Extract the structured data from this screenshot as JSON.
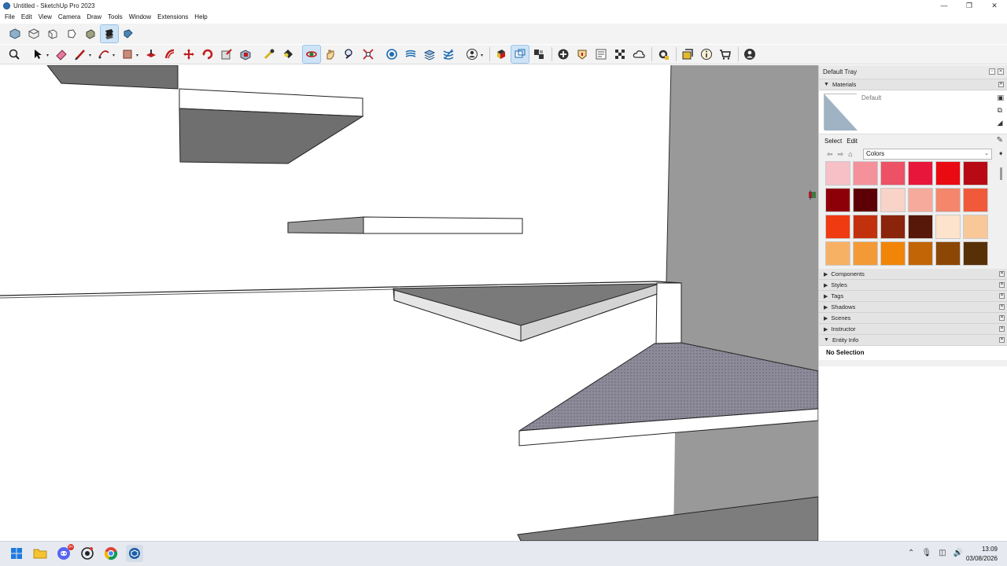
{
  "window": {
    "title": "Untitled - SketchUp Pro 2023",
    "minimize": "—",
    "maximize": "❐",
    "close": "✕"
  },
  "menu": [
    "File",
    "Edit",
    "View",
    "Camera",
    "Draw",
    "Tools",
    "Window",
    "Extensions",
    "Help"
  ],
  "toolbar_views": [
    "iso-view-icon",
    "top-view-icon",
    "front-view-icon",
    "right-view-icon",
    "back-view-icon",
    "left-view-icon",
    "bottom-view-icon"
  ],
  "toolbar_main": [
    "zoom-window-icon",
    "select-icon",
    "eraser-icon",
    "line-icon",
    "arc-icon",
    "rectangle-icon",
    "push-pull-icon",
    "offset-icon",
    "move-icon",
    "rotate-icon",
    "scale-icon",
    "follow-me-icon",
    "tape-measure-icon",
    "paint-bucket-icon",
    "orbit-icon",
    "pan-icon",
    "zoom-icon",
    "zoom-extents-icon",
    "section-plane-icon",
    "sandbox-icon",
    "layers-icon",
    "styles-icon",
    "user-icon",
    "components-icon",
    "solid-tools-icon",
    "scenes-icon",
    "add-location-icon",
    "geo-icon",
    "model-info-icon",
    "photo-texture-icon",
    "cloud-icon",
    "extension-manager-icon",
    "outliner-icon",
    "info-icon",
    "warehouse-icon",
    "account-icon"
  ],
  "tray": {
    "title": "Default Tray",
    "materials": {
      "panel_title": "Materials",
      "current_name": "Default",
      "tab_select": "Select",
      "tab_edit": "Edit",
      "collection": "Colors",
      "swatches": [
        "#f7c0c7",
        "#f4919a",
        "#ec5166",
        "#e8163a",
        "#ea0a12",
        "#b80a14",
        "#8e0008",
        "#5c0005",
        "#f9d2c8",
        "#f6aa9b",
        "#f4866b",
        "#f05a3a",
        "#ef3a12",
        "#c2310d",
        "#8a240b",
        "#581809",
        "#fde3cb",
        "#f9c899",
        "#f7b164",
        "#f39a36",
        "#f08508",
        "#c26506",
        "#8c4706",
        "#583007"
      ]
    },
    "panels": [
      "Components",
      "Styles",
      "Tags",
      "Shadows",
      "Scenes",
      "Instructor"
    ],
    "entity_info": {
      "panel_title": "Entity Info",
      "status": "No Selection"
    }
  },
  "taskbar": {
    "apps": [
      "windows-start-icon",
      "file-explorer-icon",
      "discord-icon",
      "github-icon",
      "chrome-icon",
      "sketchup-icon"
    ],
    "discord_badge": "9+",
    "time": "13:09",
    "date": "03/08/2026"
  }
}
